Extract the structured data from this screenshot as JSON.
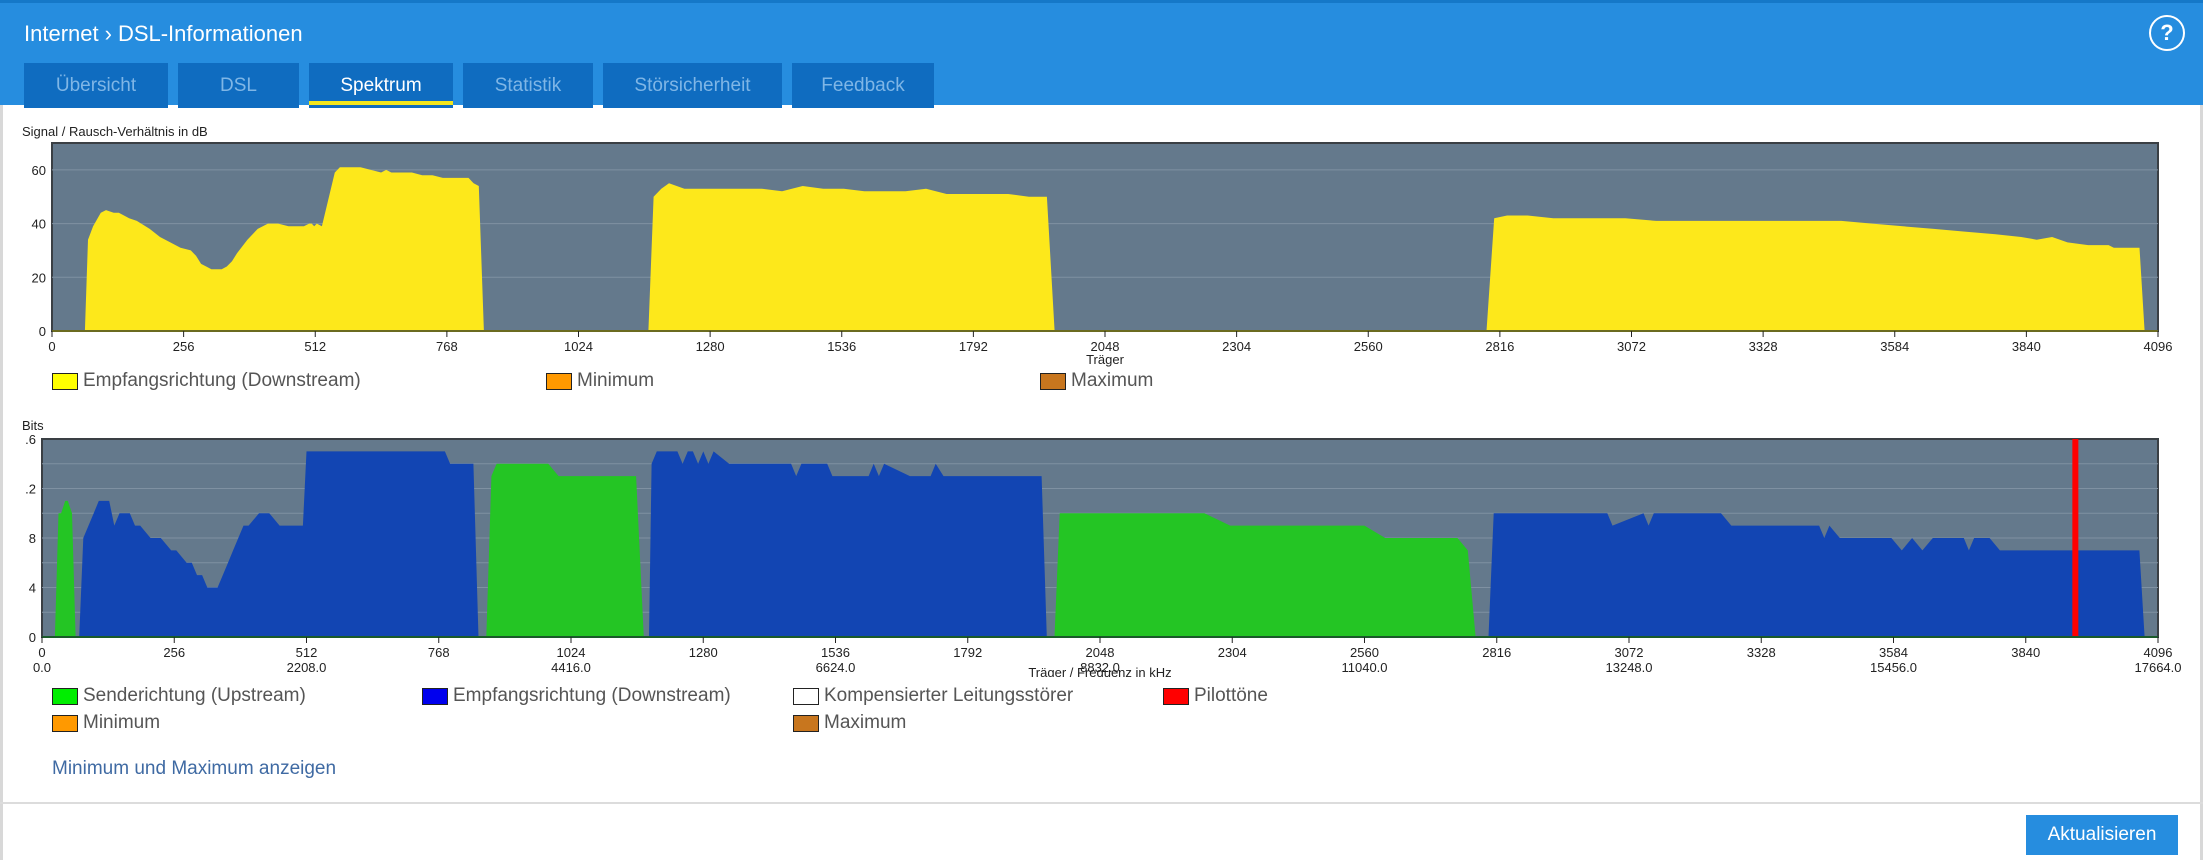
{
  "header": {
    "breadcrumb": [
      "Internet",
      "DSL-Informationen"
    ],
    "separator": "›",
    "help_icon": "?"
  },
  "tabs": [
    {
      "label": "Übersicht",
      "active": false
    },
    {
      "label": "DSL",
      "active": false
    },
    {
      "label": "Spektrum",
      "active": true
    },
    {
      "label": "Statistik",
      "active": false
    },
    {
      "label": "Störsicherheit",
      "active": false
    },
    {
      "label": "Feedback",
      "active": false
    }
  ],
  "colors": {
    "plot_bg": "#64798c",
    "snr_downstream": "#fde81b",
    "bits_downstream": "#1245b3",
    "bits_upstream": "#24c524",
    "pilot": "#ff0000",
    "legend_upstream": "#00ee00",
    "legend_downstream": "#0000ee",
    "legend_yellow": "#ffff00",
    "legend_min": "#ff9900",
    "legend_max": "#c8761e",
    "legend_compensated": "#ffffff"
  },
  "chart_data": [
    {
      "type": "area",
      "title": "Signal / Rausch-Verhältnis in dB",
      "xlabel": "Träger",
      "ylabel": "Signal / Rausch-Verhältnis in dB",
      "xlim": [
        0,
        4096
      ],
      "ylim": [
        0,
        70
      ],
      "xticks": [
        0,
        256,
        512,
        768,
        1024,
        1280,
        1536,
        1792,
        2048,
        2304,
        2560,
        2816,
        3072,
        3328,
        3584,
        3840,
        4096
      ],
      "yticks": [
        0,
        20,
        40,
        60
      ],
      "grid": true,
      "legend": [
        {
          "label": "Empfangsrichtung (Downstream)",
          "color": "#ffff00"
        },
        {
          "label": "Minimum",
          "color": "#ff9900"
        },
        {
          "label": "Maximum",
          "color": "#c8761e"
        }
      ],
      "series": [
        {
          "name": "Empfangsrichtung (Downstream)",
          "segments": [
            {
              "x": [
                64,
                70,
                80,
                95,
                105,
                120,
                130,
                150,
                165,
                190,
                210,
                230,
                250,
                270,
                280,
                290,
                300,
                310,
                320,
                330,
                340,
                350,
                360,
                380,
                400,
                420,
                440,
                460,
                470,
                480,
                490,
                500,
                505,
                510,
                515,
                525,
                550,
                560,
                570,
                580,
                600,
                620,
                640,
                650,
                660,
                680,
                700,
                720,
                740,
                760,
                780,
                800,
                810,
                820,
                830,
                840
              ],
              "y": [
                0,
                34,
                39,
                44,
                45,
                44,
                44,
                42,
                41,
                38,
                35,
                33,
                31,
                30,
                28,
                25,
                24,
                23,
                23,
                23,
                24,
                26,
                29,
                34,
                38,
                40,
                40,
                39,
                39,
                39,
                39,
                40,
                40,
                39,
                40,
                39,
                59,
                61,
                61,
                61,
                61,
                60,
                59,
                60,
                59,
                59,
                59,
                58,
                58,
                57,
                57,
                57,
                57,
                55,
                54,
                0
              ]
            },
            {
              "x": [
                1160,
                1170,
                1185,
                1200,
                1215,
                1230,
                1260,
                1300,
                1340,
                1380,
                1420,
                1460,
                1500,
                1540,
                1580,
                1620,
                1660,
                1700,
                1740,
                1780,
                1820,
                1860,
                1900,
                1935,
                1950
              ],
              "y": [
                0,
                50,
                53,
                55,
                54,
                53,
                53,
                53,
                53,
                53,
                52,
                54,
                53,
                53,
                52,
                52,
                52,
                53,
                51,
                51,
                51,
                51,
                50,
                50,
                0
              ]
            },
            {
              "x": [
                2790,
                2805,
                2830,
                2870,
                2920,
                2960,
                3000,
                3060,
                3120,
                3180,
                3240,
                3300,
                3360,
                3420,
                3480,
                3540,
                3600,
                3660,
                3720,
                3780,
                3830,
                3860,
                3890,
                3920,
                3960,
                3990,
                4000,
                4010,
                4060,
                4070
              ],
              "y": [
                0,
                42,
                43,
                43,
                42,
                42,
                42,
                42,
                41,
                41,
                41,
                41,
                41,
                41,
                41,
                40,
                39,
                38,
                37,
                36,
                35,
                34,
                35,
                33,
                32,
                32,
                32,
                31,
                31,
                0
              ]
            }
          ]
        }
      ]
    },
    {
      "type": "area",
      "title": "Bits",
      "xlabel": "Träger / Frequenz in kHz",
      "ylabel": "Bits",
      "xlim": [
        0,
        4096
      ],
      "ylim": [
        0,
        16
      ],
      "xticks": [
        0,
        256,
        512,
        768,
        1024,
        1280,
        1536,
        1792,
        2048,
        2304,
        2560,
        2816,
        3072,
        3328,
        3584,
        3840,
        4096
      ],
      "xticks_secondary": {
        "0": "0.0",
        "512": "2208.0",
        "1024": "4416.0",
        "1536": "6624.0",
        "2048": "8832.0",
        "2560": "11040.0",
        "3072": "13248.0",
        "3584": "15456.0",
        "4096": "17664.0"
      },
      "ytick_labels": [
        ".6",
        ".2",
        "8",
        "4",
        "0"
      ],
      "yticks": [
        16,
        12,
        8,
        4,
        0
      ],
      "grid": true,
      "legend": [
        {
          "label": "Senderichtung (Upstream)",
          "color": "#00ee00"
        },
        {
          "label": "Empfangsrichtung (Downstream)",
          "color": "#0000ee"
        },
        {
          "label": "Kompensierter Leitungsstörer",
          "color": "#ffffff"
        },
        {
          "label": "Pilottöne",
          "color": "#ff0000"
        },
        {
          "label": "Minimum",
          "color": "#ff9900"
        },
        {
          "label": "Maximum",
          "color": "#c8761e"
        }
      ],
      "series": [
        {
          "name": "Senderichtung (Upstream)",
          "segments": [
            {
              "x": [
                25,
                32,
                37,
                45,
                50,
                58,
                65
              ],
              "y": [
                0,
                10,
                10,
                11,
                11,
                10,
                0
              ]
            },
            {
              "x": [
                860,
                870,
                880,
                900,
                930,
                980,
                1000,
                1060,
                1120,
                1150,
                1165
              ],
              "y": [
                0,
                13,
                14,
                14,
                14,
                14,
                13,
                13,
                13,
                13,
                0
              ]
            },
            {
              "x": [
                1960,
                1970,
                2000,
                2100,
                2170,
                2200,
                2250,
                2300,
                2350,
                2420,
                2500,
                2560,
                2600,
                2660,
                2700,
                2740,
                2760,
                2775
              ],
              "y": [
                0,
                10,
                10,
                10,
                10,
                10,
                10,
                9,
                9,
                9,
                9,
                9,
                8,
                8,
                8,
                8,
                7,
                0
              ]
            }
          ]
        },
        {
          "name": "Empfangsrichtung (Downstream)",
          "segments": [
            {
              "x": [
                72,
                80,
                90,
                100,
                110,
                120,
                130,
                140,
                150,
                160,
                170,
                180,
                190,
                210,
                230,
                250,
                260,
                280,
                290,
                300,
                310,
                320,
                330,
                340,
                350,
                360,
                370,
                380,
                390,
                400,
                420,
                440,
                460,
                480,
                500,
                505,
                512,
                530,
                560,
                600,
                650,
                700,
                750,
                780,
                790,
                800,
                820,
                835,
                845
              ],
              "y": [
                0,
                8,
                9,
                10,
                11,
                11,
                11,
                9,
                10,
                10,
                10,
                9,
                9,
                8,
                8,
                7,
                7,
                6,
                6,
                5,
                5,
                4,
                4,
                4,
                5,
                6,
                7,
                8,
                9,
                9,
                10,
                10,
                9,
                9,
                9,
                9,
                15,
                15,
                15,
                15,
                15,
                15,
                15,
                15,
                14,
                14,
                14,
                14,
                0
              ]
            },
            {
              "x": [
                1175,
                1180,
                1190,
                1230,
                1240,
                1250,
                1260,
                1270,
                1280,
                1290,
                1300,
                1330,
                1340,
                1380,
                1450,
                1460,
                1470,
                1520,
                1530,
                1560,
                1600,
                1610,
                1620,
                1630,
                1680,
                1720,
                1730,
                1745,
                1760,
                1935,
                1945
              ],
              "y": [
                0,
                14,
                15,
                15,
                14,
                15,
                15,
                14,
                15,
                14,
                15,
                14,
                14,
                14,
                14,
                13,
                14,
                14,
                13,
                13,
                13,
                14,
                13,
                14,
                13,
                13,
                14,
                13,
                13,
                13,
                0
              ]
            },
            {
              "x": [
                2800,
                2810,
                3000,
                3030,
                3040,
                3100,
                3110,
                3120,
                3250,
                3270,
                3440,
                3450,
                3460,
                3480,
                3580,
                3600,
                3620,
                3640,
                3660,
                3720,
                3730,
                3740,
                3770,
                3790,
                3800,
                4060,
                4070
              ],
              "y": [
                0,
                10,
                10,
                10,
                9,
                10,
                9,
                10,
                10,
                9,
                9,
                8,
                9,
                8,
                8,
                7,
                8,
                7,
                8,
                8,
                7,
                8,
                8,
                7,
                7,
                7,
                0
              ]
            }
          ]
        },
        {
          "name": "Pilottöne",
          "bars": [
            {
              "x": 3936,
              "y": 16
            }
          ]
        }
      ]
    }
  ],
  "footer": {
    "toggle_link": "Minimum und Maximum anzeigen",
    "refresh_button": "Aktualisieren"
  }
}
